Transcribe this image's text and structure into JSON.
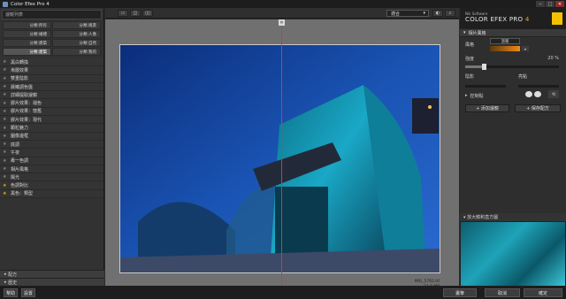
{
  "window": {
    "title": "Color Efex Pro 4",
    "min": "─",
    "max": "□",
    "close": "✕"
  },
  "left_panel": {
    "search_placeholder": "濾鏡列表",
    "categories": [
      {
        "label": "分類:所有"
      },
      {
        "label": "分類:風景"
      },
      {
        "label": "分類:婚禮"
      },
      {
        "label": "分類:人像"
      },
      {
        "label": "分類:建築"
      },
      {
        "label": "分類:自然"
      },
      {
        "label": "分類:建築"
      },
      {
        "label": "分類:我的"
      }
    ],
    "filters": [
      {
        "name": "黑白轉換",
        "fav": false
      },
      {
        "name": "漸層效果",
        "fav": false
      },
      {
        "name": "雙重陰影",
        "fav": false
      },
      {
        "name": "晨曦調色盤",
        "fav": false
      },
      {
        "name": "詳細提取濾鏡",
        "fav": false
      },
      {
        "name": "膠片效果：褪色",
        "fav": false
      },
      {
        "name": "膠片效果：懷舊",
        "fav": false
      },
      {
        "name": "膠片效果：現代",
        "fav": false
      },
      {
        "name": "顆粒魅力",
        "fav": false
      },
      {
        "name": "圖像邊框",
        "fav": false
      },
      {
        "name": "底調",
        "fav": false
      },
      {
        "name": "午夜",
        "fav": false
      },
      {
        "name": "專一色調",
        "fav": false
      },
      {
        "name": "相片風格",
        "fav": false
      },
      {
        "name": "陽光",
        "fav": false
      },
      {
        "name": "色調對比",
        "fav": true
      },
      {
        "name": "黑色：類型",
        "fav": true
      }
    ],
    "presets_label": "配方",
    "history_label": "歷史"
  },
  "toolbar": {
    "view_single": "▭",
    "view_split": "◫",
    "view_side": "▯▯",
    "zoom_value": "適合",
    "bg_toggle": "◐",
    "loupe_toggle": "⌕"
  },
  "canvas": {
    "file_name": "IMG_5762.tif",
    "file_size": "21.6 MP",
    "split_handle": "✕"
  },
  "right_panel": {
    "brand_company": "Nik Software",
    "brand_product": "COLOR EFEX PRO",
    "brand_version": "4",
    "section_title": "相片風格",
    "style_label": "風格",
    "style_value": "溫暖",
    "strength_label": "強度",
    "strength_value": "20 %",
    "strength_fraction": 0.2,
    "shadows_label": "陰影",
    "highlights_label": "亮點",
    "control_points_label": "控制點",
    "add_filter_button": "添加濾鏡",
    "save_recipe_button": "保存配方",
    "loupe_title": "放大鏡和直方圖"
  },
  "bottom_bar": {
    "help": "幫助",
    "settings": "設置",
    "brush": "畫筆",
    "cancel": "取消",
    "ok": "確定"
  }
}
